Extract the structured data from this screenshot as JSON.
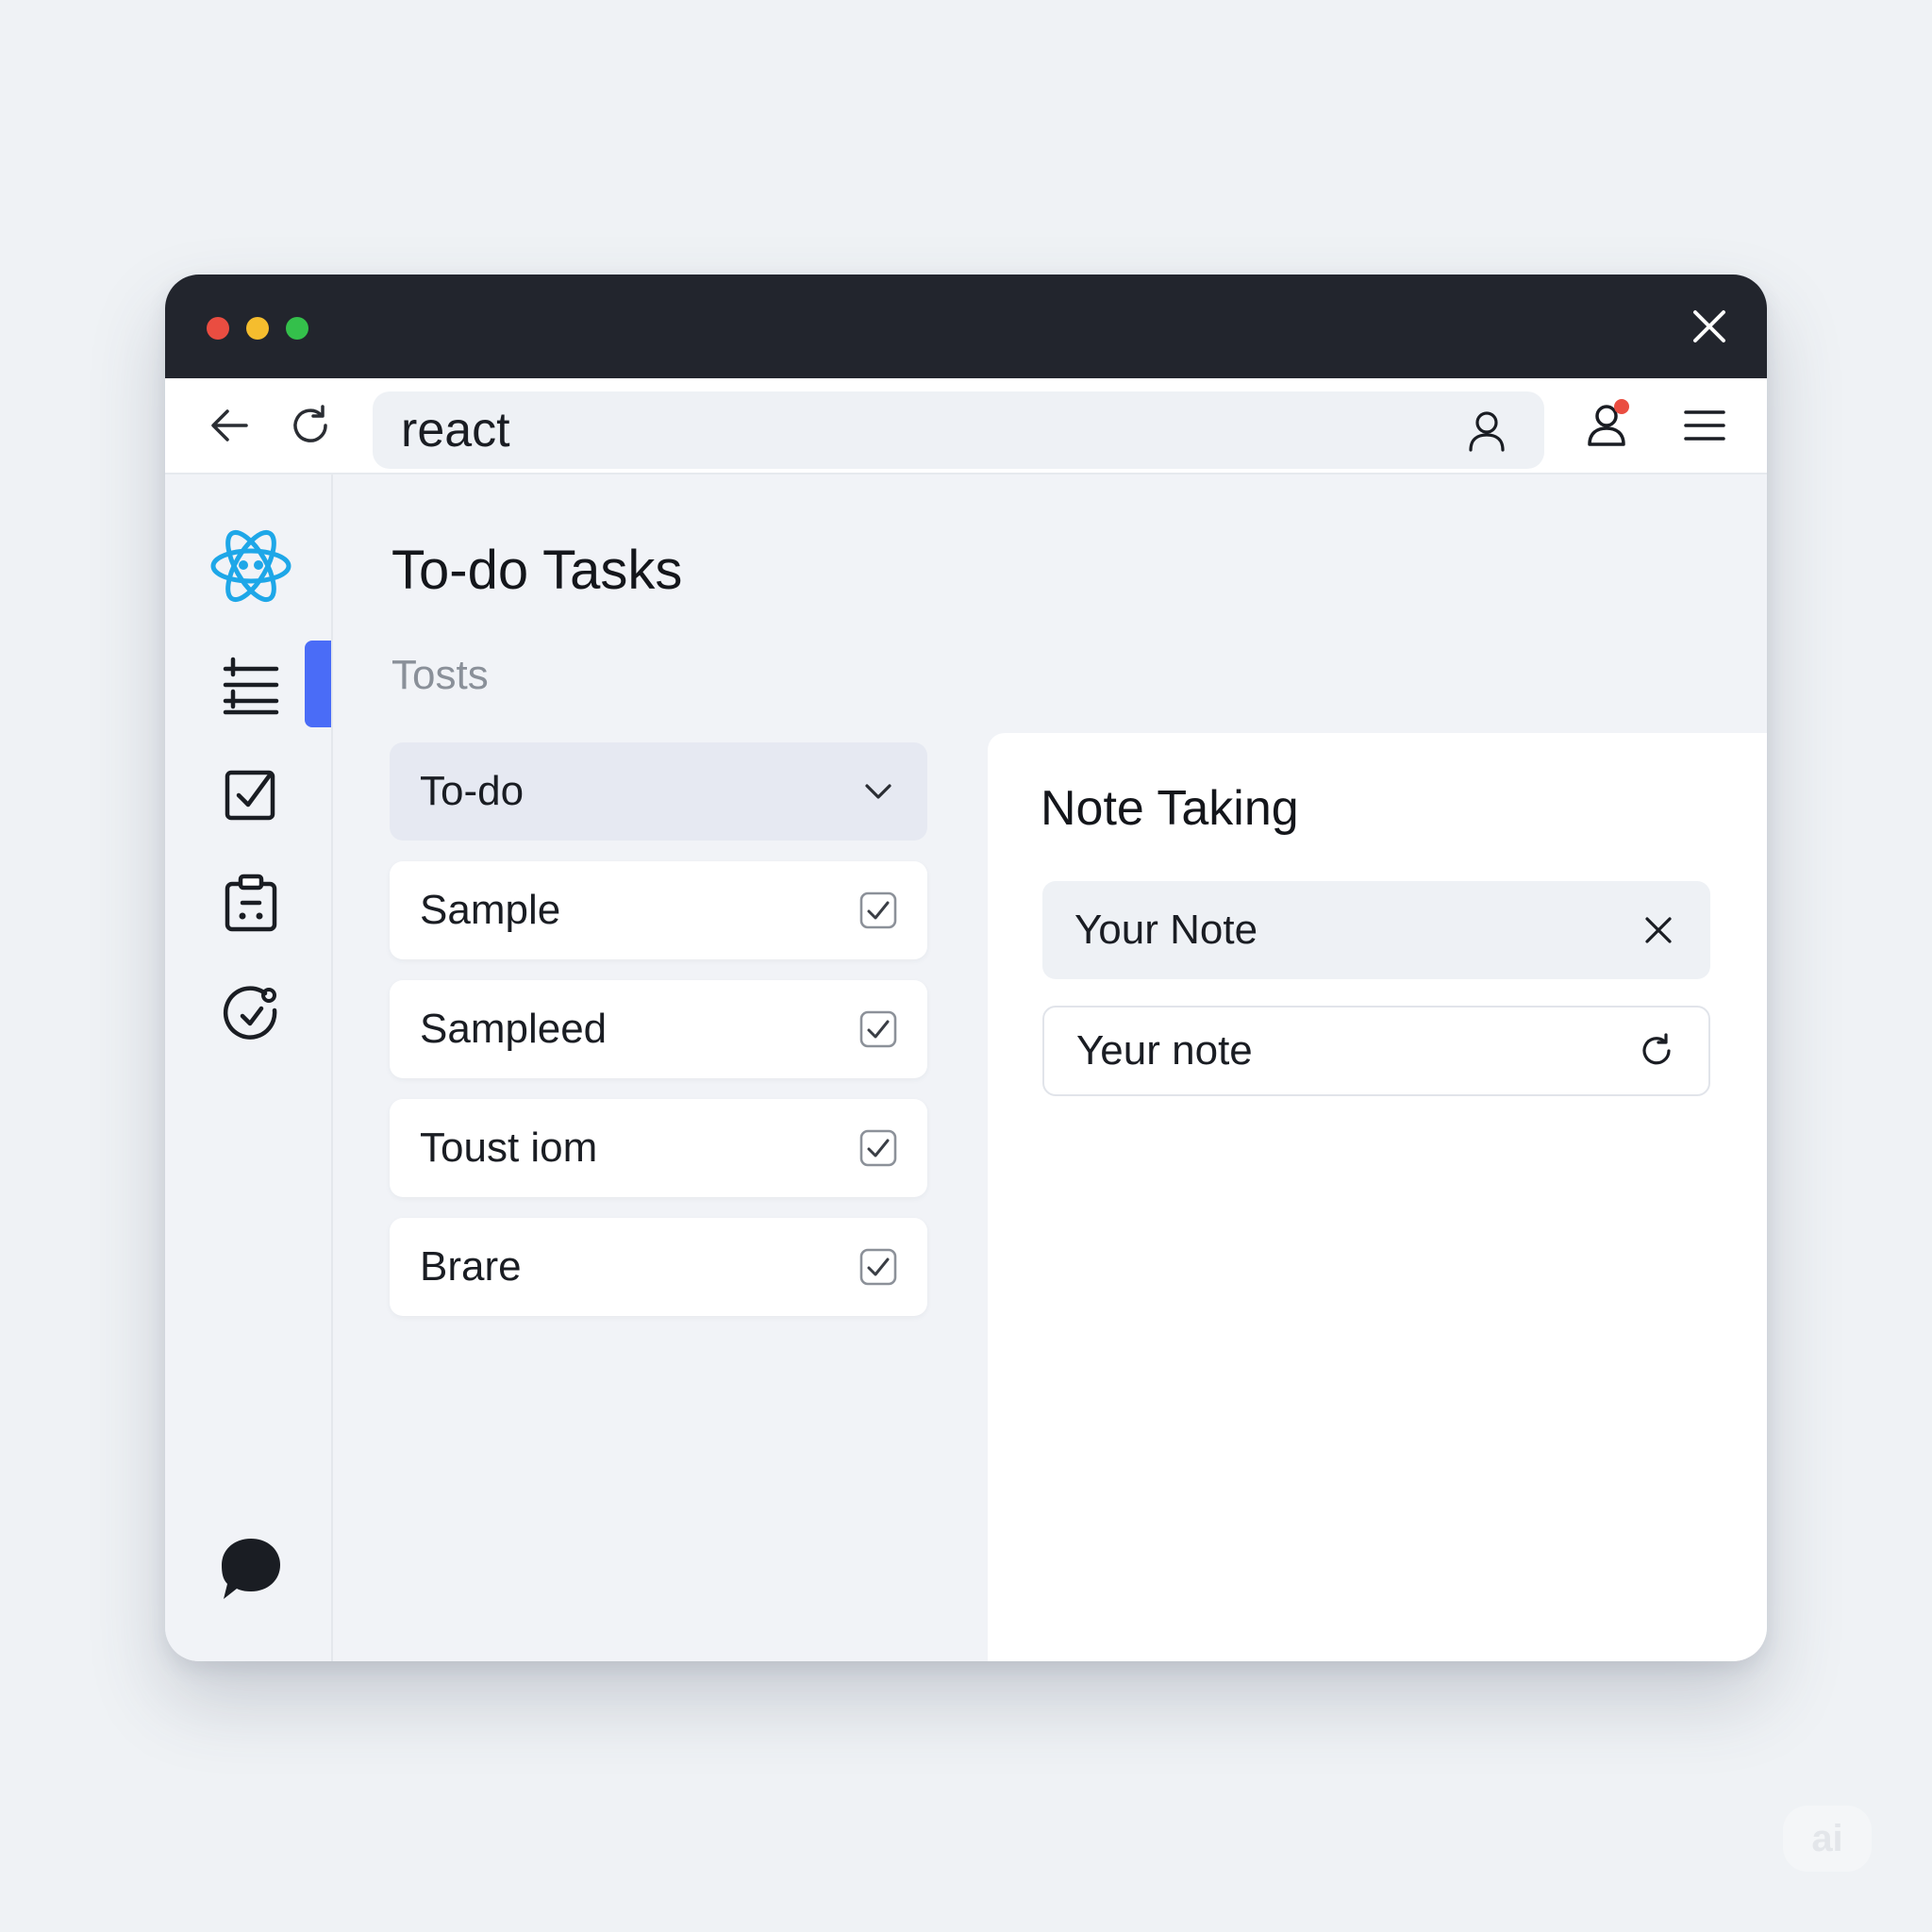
{
  "browser": {
    "address_text": "react"
  },
  "page": {
    "title": "To-do Tasks",
    "subtitle": "Tosts"
  },
  "tasks": [
    {
      "label": "To-do",
      "icon": "chevron-down-icon",
      "selected": true
    },
    {
      "label": "Sample",
      "icon": "checkbox-checked-icon",
      "checked": true
    },
    {
      "label": "Sampleed",
      "icon": "checkbox-checked-icon",
      "checked": true
    },
    {
      "label": "Toust iom",
      "icon": "checkbox-checked-icon",
      "checked": true
    },
    {
      "label": "Brare",
      "icon": "checkbox-checked-icon",
      "checked": true
    }
  ],
  "notes": {
    "title": "Note Taking",
    "fields": [
      {
        "value": "Your Note",
        "icon": "close-icon"
      },
      {
        "value": "Yeur note",
        "icon": "refresh-icon"
      }
    ]
  },
  "sidebar": {
    "items": [
      {
        "icon": "react-logo-icon"
      },
      {
        "icon": "list-icon",
        "active": true
      },
      {
        "icon": "checklist-icon"
      },
      {
        "icon": "clipboard-icon"
      },
      {
        "icon": "timer-icon"
      },
      {
        "icon": "chat-icon"
      }
    ]
  },
  "watermark": {
    "text": "ai"
  },
  "colors": {
    "accent": "#4a6cf7",
    "react_blue": "#1ea7e8",
    "titlebar": "#22252d",
    "notification_dot": "#ea4d41"
  }
}
